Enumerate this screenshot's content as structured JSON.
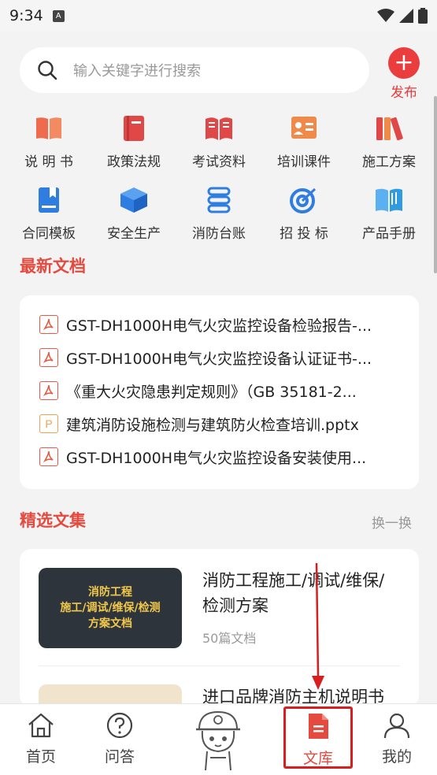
{
  "status": {
    "time": "9:34",
    "notif_letter": "A"
  },
  "search": {
    "placeholder": "输入关键字进行搜索"
  },
  "publish": {
    "label": "发布"
  },
  "categories": [
    {
      "label": "说 明 书",
      "icon": "book-open-icon",
      "color": "#ee6c4d"
    },
    {
      "label": "政策法规",
      "icon": "book-icon",
      "color": "#e04848"
    },
    {
      "label": "考试资料",
      "icon": "open-book-icon",
      "color": "#e04848"
    },
    {
      "label": "培训课件",
      "icon": "presentation-icon",
      "color": "#f08a4b"
    },
    {
      "label": "施工方案",
      "icon": "books-icon",
      "color": "#e04848"
    },
    {
      "label": "合同模板",
      "icon": "bookmark-doc-icon",
      "color": "#2f7de1"
    },
    {
      "label": "安全生产",
      "icon": "cube-icon",
      "color": "#2f7de1"
    },
    {
      "label": "消防台账",
      "icon": "stack-icon",
      "color": "#2f7de1"
    },
    {
      "label": "招 投 标",
      "icon": "target-icon",
      "color": "#2f7de1"
    },
    {
      "label": "产品手册",
      "icon": "manual-icon",
      "color": "#2f9be1"
    }
  ],
  "latest": {
    "title": "最新文档",
    "items": [
      {
        "name": "GST-DH1000H电气火灾监控设备检验报告-...",
        "type": "pdf"
      },
      {
        "name": "GST-DH1000H电气火灾监控设备认证证书-...",
        "type": "pdf"
      },
      {
        "name": "《重大火灾隐患判定规则》（GB 35181-2...",
        "type": "pdf"
      },
      {
        "name": "建筑消防设施检测与建筑防火检查培训.pptx",
        "type": "ppt"
      },
      {
        "name": "GST-DH1000H电气火灾监控设备安装使用...",
        "type": "pdf"
      }
    ]
  },
  "featured": {
    "title": "精选文集",
    "refresh": "换一换",
    "items": [
      {
        "cover_lines": [
          "消防工程",
          "施工/调试/维保/检测",
          "方案文档"
        ],
        "title": "消防工程施工/调试/维保/检测方案",
        "count": "50篇文档"
      },
      {
        "title": "进口品牌消防主机说明书"
      }
    ]
  },
  "tabs": [
    {
      "label": "首页",
      "icon": "home-icon"
    },
    {
      "label": "问答",
      "icon": "question-icon"
    },
    {
      "label": "",
      "icon": "mascot-icon"
    },
    {
      "label": "文库",
      "icon": "library-icon",
      "active": true
    },
    {
      "label": "我的",
      "icon": "user-icon"
    }
  ],
  "colors": {
    "accent": "#e54a3f",
    "annotation": "#d81e1e"
  }
}
